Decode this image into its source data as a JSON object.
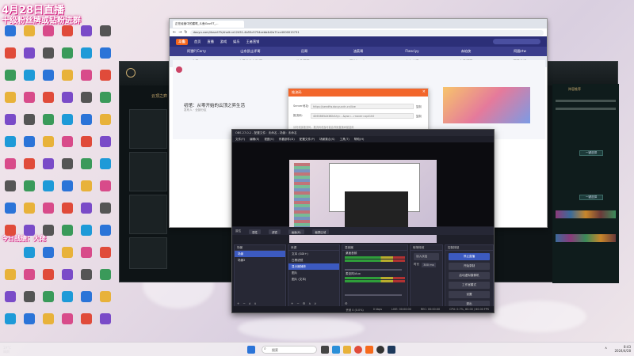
{
  "overlay": {
    "line1": "4月28日直播",
    "line2": "十级粉丝牌或钻粉进群",
    "line3": "今日战绩：大佬"
  },
  "desktop": {
    "weather_temp": "19°C",
    "weather_desc": "晴朗"
  },
  "browser": {
    "tab_title": "正在经营中的建筑_斗鱼Gov5T_...",
    "url": "douyu.com/4ssrct?fr/sholt=e12451-4b55c9754cebb4d2a71cc4000015731",
    "site_logo": "斗鱼",
    "nav": [
      "首页",
      "直播",
      "游戏",
      "娱乐",
      "王者营销"
    ],
    "rooms_top": [
      "阿狸吖Carry",
      "山东凯士评哥",
      "迅哥",
      "油菜哥",
      "Flanciyy",
      "赤焰侠",
      "阿圆ctw"
    ],
    "rooms_bottom": [
      "夜子~",
      "丸子头的女孩帽",
      "仙凡哥哥~",
      "星旗korol~",
      "串串小漫",
      "宝贝瓶哥",
      "可爱的姐"
    ],
    "room_title": "初馆：从零开始的云顶之弈生活",
    "room_sub": "发布人 · 全部分区"
  },
  "dialog": {
    "title": "推流码",
    "server_label": "Server地址:",
    "server_value": "https://sendfw.douyucdn.cn/live",
    "key_label": "推流码:",
    "key_value": "4065865AX8KhAhj=...&pw=...rnaver=opt1h0",
    "copy": "复制",
    "note": "请勿泄露推流码，推流码泄露可能会导致直播间被盗用"
  },
  "obs": {
    "title": "OBS 27.0.2 - 配置文件：未命名 - 场景：未命名",
    "menu": [
      "文件(F)",
      "编辑(E)",
      "视图(V)",
      "停靠部件(D)",
      "配置文件(P)",
      "场景集合(S)",
      "工具(T)",
      "帮助(H)"
    ],
    "source_bar": [
      "属性",
      "滤镜",
      "图像",
      "画面"
    ],
    "top_buttons": [
      "属性",
      "滤镜",
      "画面(R)",
      "截屏区域"
    ],
    "scenes_title": "场景",
    "scenes": [
      "场景",
      "场景2"
    ],
    "sources_title": "来源",
    "sources": [
      "文本 (GDI+)",
      "白黑滤镜",
      "显示器捕获",
      "图片",
      "图片 (文本)"
    ],
    "mixer_title": "混音器",
    "mixer_items": [
      "桌面音频",
      "麦克风/Aux"
    ],
    "transitions_title": "转场特效",
    "transition_type": "淡入淡出",
    "duration_label": "时长",
    "duration_value": "300 ms",
    "controls_title": "控制按钮",
    "controls": [
      "停止直播",
      "开始录制",
      "启动虚拟摄像机",
      "工作室模式",
      "设置",
      "退出"
    ],
    "status": [
      "丢帧 0 (0.0%)",
      "0 kbps",
      "LIVE: 00:00:00",
      "REC: 00:00:00",
      "CPU: 0.7%, 60.00 / 60.00 FPS"
    ]
  },
  "game": {
    "title": "云顶之弈",
    "right_title": "阵容推荐",
    "btn_label": "一键选择"
  },
  "taskbar": {
    "search_placeholder": "搜索",
    "time": "8:43",
    "date": "2024/4/28"
  }
}
